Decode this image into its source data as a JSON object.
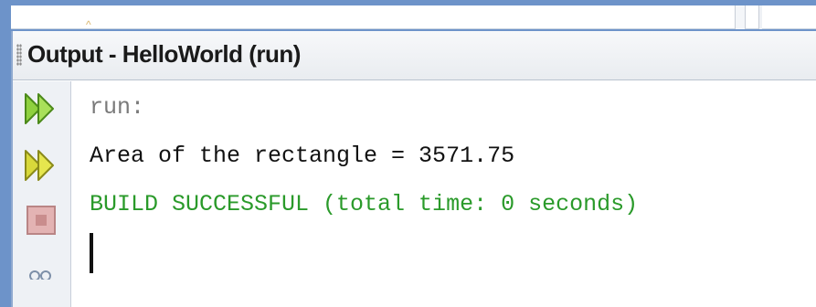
{
  "window": {
    "title": "Output - HelloWorld (run)"
  },
  "toolbar": {
    "icons": [
      "rerun-icon",
      "rerun-with-options-icon",
      "stop-icon",
      "more-icon"
    ]
  },
  "console": {
    "lines": [
      {
        "kind": "info",
        "text": "run:"
      },
      {
        "kind": "stdout",
        "text": "Area of the rectangle = 3571.75"
      },
      {
        "kind": "success",
        "text": "BUILD SUCCESSFUL (total time: 0 seconds)"
      }
    ]
  },
  "colors": {
    "frame": "#6d93c9",
    "info_text": "#7a7a7a",
    "stdout_text": "#111111",
    "success_text": "#2a9a2a",
    "rerun_icon": "#8fd13f",
    "rerun_alt_icon": "#d8d83a",
    "stop_icon": "#d79a9a"
  }
}
